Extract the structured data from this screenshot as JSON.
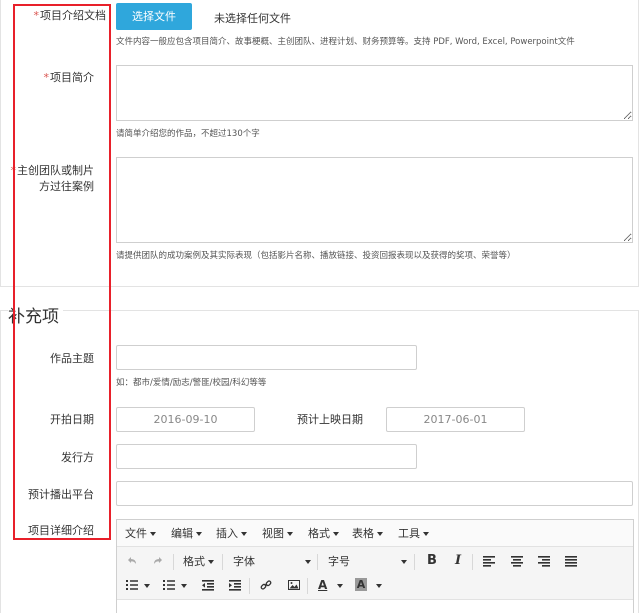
{
  "section1": {
    "doc": {
      "required_mark": "*",
      "label": "项目介绍文档",
      "choose_button": "选择文件",
      "file_status": "未选择任何文件",
      "hint": "文件内容一般应包含项目简介、故事梗概、主创团队、进程计划、财务预算等。支持 PDF, Word, Excel, Powerpoint文件"
    },
    "intro": {
      "required_mark": "*",
      "label": "项目简介",
      "hint": "请简单介绍您的作品，不超过130个字"
    },
    "team": {
      "required_mark": "*",
      "label_line1": "主创团队或制片",
      "label_line2": "方过往案例",
      "hint": "请提供团队的成功案例及其实际表现（包括影片名称、播放链接、投资回报表现以及获得的奖项、荣誉等）"
    }
  },
  "section2": {
    "title": "补充项",
    "theme": {
      "label": "作品主题",
      "value": "",
      "hint": "如：都市/爱情/励志/警匪/校园/科幻等等"
    },
    "shoot_date": {
      "label": "开拍日期",
      "value": "2016-09-10"
    },
    "release_date": {
      "label": "预计上映日期",
      "value": "2017-06-01"
    },
    "publisher": {
      "label": "发行方",
      "value": ""
    },
    "platform": {
      "label": "预计播出平台",
      "value": ""
    },
    "details": {
      "label": "项目详细介绍"
    }
  },
  "editor": {
    "menu": [
      "文件",
      "编辑",
      "插入",
      "视图",
      "格式",
      "表格",
      "工具"
    ],
    "format_label": "格式",
    "font_label": "字体",
    "size_label": "字号",
    "bold": "B",
    "italic": "I",
    "font_color": "A",
    "bg_color": "A",
    "accent_color": "#2fa7dc",
    "required_color": "#d9534f",
    "highlight_box_color": "#e8202a"
  }
}
